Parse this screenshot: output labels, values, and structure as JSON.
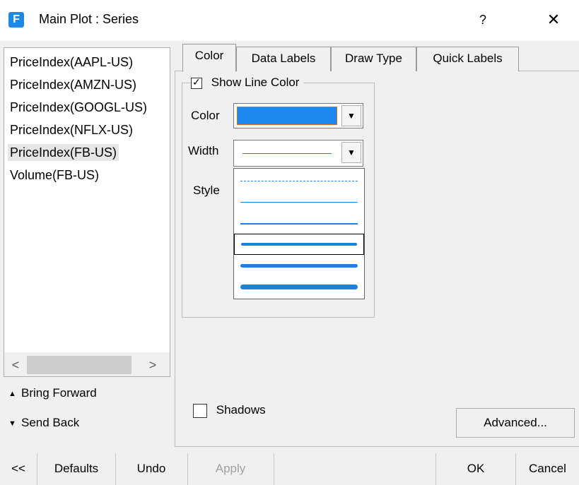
{
  "window": {
    "title": "Main Plot : Series",
    "app_icon_letter": "F",
    "help_label": "?",
    "close_label": "✕"
  },
  "series_list": {
    "items": [
      "PriceIndex(AAPL-US)",
      "PriceIndex(AMZN-US)",
      "PriceIndex(GOOGL-US)",
      "PriceIndex(NFLX-US)",
      "PriceIndex(FB-US)",
      "Volume(FB-US)"
    ],
    "selected_index": 4,
    "scroll_left": "<",
    "scroll_right": ">"
  },
  "order_buttons": {
    "bring_forward": "Bring Forward",
    "send_back": "Send Back"
  },
  "tabs": [
    {
      "label": "Color",
      "active": true
    },
    {
      "label": "Data Labels",
      "active": false
    },
    {
      "label": "Draw Type",
      "active": false
    },
    {
      "label": "Quick Labels",
      "active": false
    }
  ],
  "color_tab": {
    "show_line_color_label": "Show Line Color",
    "show_line_color_checked": true,
    "color_label": "Color",
    "color_value": "#1e88f0",
    "width_label": "Width",
    "style_label": "Style",
    "width_options_count": 6,
    "width_focused_index": 3,
    "shadows_label": "Shadows",
    "shadows_checked": false,
    "advanced_label": "Advanced..."
  },
  "bottom_bar": {
    "collapse_label": "<<",
    "defaults_label": "Defaults",
    "undo_label": "Undo",
    "apply_label": "Apply",
    "ok_label": "OK",
    "cancel_label": "Cancel"
  },
  "colors": {
    "accent": "#1e88e5",
    "line_blue": "#1f7fe0",
    "window_bg": "#f0f0f0"
  }
}
